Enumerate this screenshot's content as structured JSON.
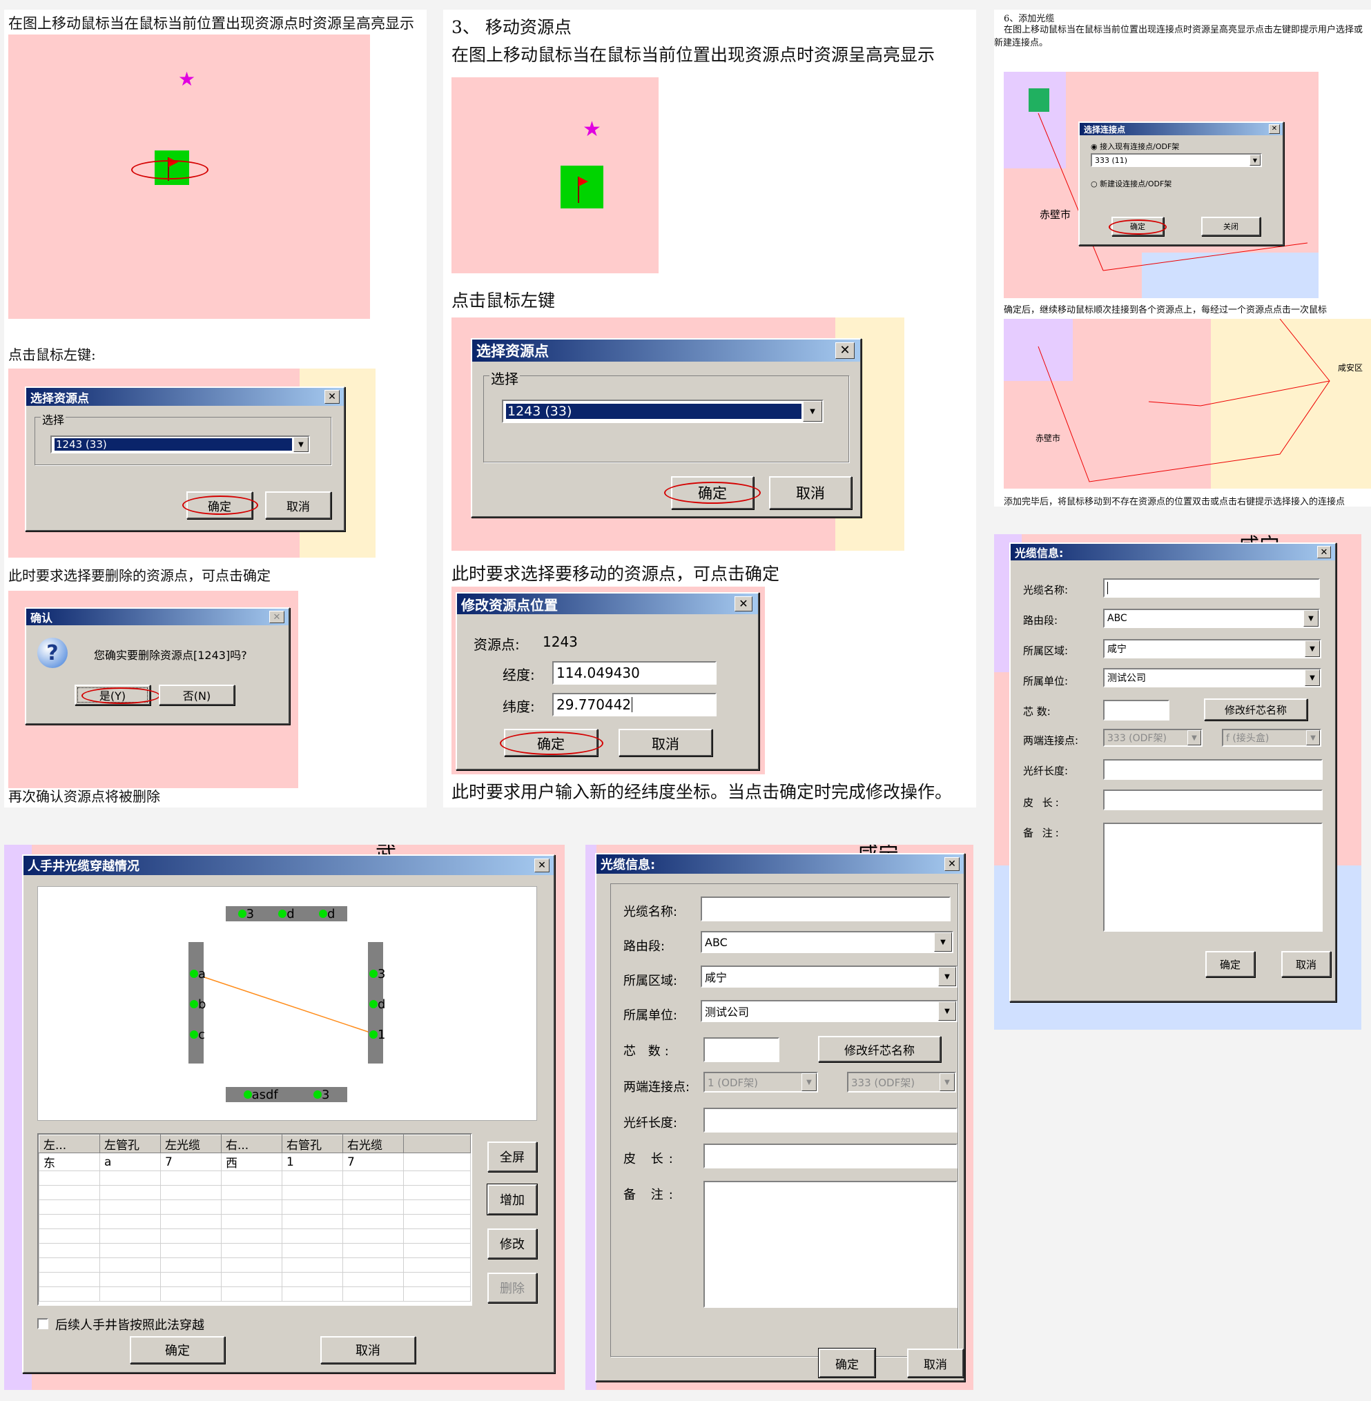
{
  "panel1": {
    "caption_top": "在图上移动鼠标当在鼠标当前位置出现资源点时资源呈高亮显示",
    "caption_click": "点击鼠标左键:",
    "dialog_title": "选择资源点",
    "group_label": "选择",
    "select_value": "1243 (33)",
    "ok": "确定",
    "cancel": "取消",
    "caption_select": "此时要求选择要删除的资源点，可点击确定",
    "confirm_title": "确认",
    "confirm_message": "您确实要删除资源点[1243]吗?",
    "yes": "是(Y)",
    "no": "否(N)",
    "caption_final": "再次确认资源点将被删除"
  },
  "panel2": {
    "heading": "3、 移动资源点",
    "caption_top": "在图上移动鼠标当在鼠标当前位置出现资源点时资源呈高亮显示",
    "caption_click": "点击鼠标左键",
    "dialog_title": "选择资源点",
    "group_label": "选择",
    "select_value": "1243 (33)",
    "ok": "确定",
    "cancel": "取消",
    "caption_select": "此时要求选择要移动的资源点，可点击确定",
    "modify_title": "修改资源点位置",
    "point_label": "资源点:",
    "point_value": "1243",
    "lon_label": "经度:",
    "lon_value": "114.049430",
    "lat_label": "纬度:",
    "lat_value": "29.770442",
    "caption_final": "此时要求用户输入新的经纬度坐标。当点击确定时完成修改操作。"
  },
  "panel3": {
    "heading": "6、添加光缆",
    "caption_top": "在图上移动鼠标当在鼠标当前位置出现连接点时资源呈高亮显示点击左键即提示用户选择或新建连接点。",
    "dialog_title": "选择连接点",
    "radio1": "接入现有连接点/ODF架",
    "select_value": "333 (11)",
    "radio2": "新建设连接点/ODF架",
    "ok": "确定",
    "close": "关闭",
    "city": "赤壁市",
    "caption_mid": "确定后，继续移动鼠标顺次挂接到各个资源点上，每经过一个资源点点击一次鼠标",
    "city2": "赤壁市",
    "district": "咸安区",
    "caption_bottom": "添加完毕后，将鼠标移动到不存在资源点的位置双击或点击右键提示选择接入的连接点"
  },
  "cable_small": {
    "title": "光缆信息:",
    "name_label": "光缆名称:",
    "name_value": "",
    "route_label": "路由段:",
    "route_value": "ABC",
    "region_label": "所属区域:",
    "region_value": "咸宁",
    "unit_label": "所属单位:",
    "unit_value": "测试公司",
    "cores_label": "芯 数:",
    "cores_value": "",
    "rename_btn": "修改纤芯名称",
    "ends_label": "两端连接点:",
    "end1": "333 (ODF架)",
    "end2": "f (接头盒)",
    "fiber_label": "光纤长度:",
    "skin_label": "皮 长:",
    "note_label": "备 注:",
    "ok": "确定",
    "cancel": "取消",
    "map_text": "咸宁"
  },
  "manhole": {
    "title": "人手井光缆穿越情况",
    "top_ports": [
      "3",
      "d",
      "d"
    ],
    "left_ports": [
      "a",
      "b",
      "c"
    ],
    "right_ports": [
      "3",
      "d",
      "1"
    ],
    "bottom_ports": [
      "asdf",
      "3"
    ],
    "columns": [
      "左...",
      "左管孔",
      "左光缆",
      "右...",
      "右管孔",
      "右光缆"
    ],
    "rows": [
      [
        "东",
        "a",
        "7",
        "西",
        "1",
        "7"
      ]
    ],
    "btn_full": "全屏",
    "btn_add": "增加",
    "btn_edit": "修改",
    "btn_delete": "删除",
    "checkbox_label": "后续人手井皆按照此法穿越",
    "ok": "确定",
    "cancel": "取消",
    "map_text": "武"
  },
  "cable_big": {
    "title": "光缆信息:",
    "name_label": "光缆名称:",
    "route_label": "路由段:",
    "route_value": "ABC",
    "region_label": "所属区域:",
    "region_value": "咸宁",
    "unit_label": "所属单位:",
    "unit_value": "测试公司",
    "cores_label": "芯 数:",
    "rename_btn": "修改纤芯名称",
    "ends_label": "两端连接点:",
    "end1": "1 (ODF架)",
    "end2": "333 (ODF架)",
    "fiber_label": "光纤长度:",
    "skin_label": "皮 长:",
    "note_label": "备 注:",
    "ok": "确定",
    "cancel": "取消",
    "map_text": "咸宁"
  },
  "colors": {
    "map_pink": "#ffcccc",
    "map_cream": "#fff2cc",
    "map_lilac": "#e6ccff",
    "titlebar": "#0a246a",
    "highlight": "#d40000"
  }
}
